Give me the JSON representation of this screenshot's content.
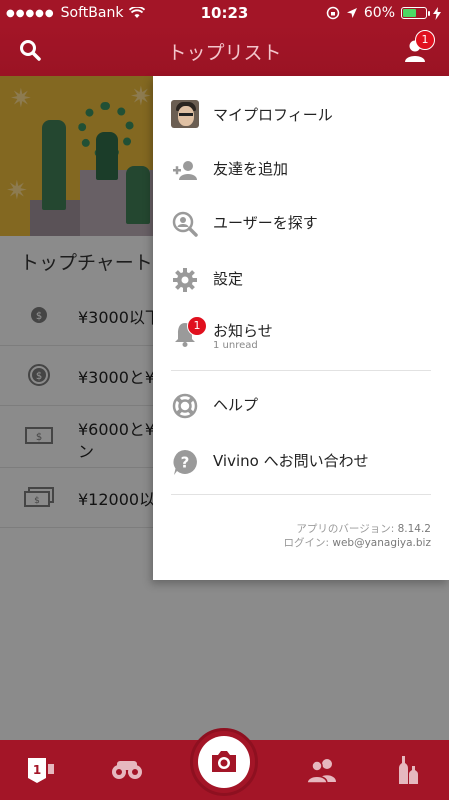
{
  "status_bar": {
    "carrier": "SoftBank",
    "time": "10:23",
    "battery_pct": "60%",
    "battery_level": 0.6
  },
  "nav": {
    "title": "トップリスト",
    "notification_count": "1"
  },
  "background": {
    "section_title": "トップチャート",
    "rows": [
      {
        "line1": "¥3000以下",
        "line2": ""
      },
      {
        "line1": "¥3000と¥",
        "line2": ""
      },
      {
        "line1": "¥6000と¥",
        "line2": "ン"
      },
      {
        "line1": "¥12000以",
        "line2": ""
      }
    ]
  },
  "menu": {
    "items": [
      {
        "label": "マイプロフィール",
        "icon": "avatar"
      },
      {
        "label": "友達を追加",
        "icon": "add-friend-icon"
      },
      {
        "label": "ユーザーを探す",
        "icon": "search-user-icon"
      },
      {
        "label": "設定",
        "icon": "gear-icon"
      },
      {
        "label": "お知らせ",
        "sub": "1 unread",
        "badge": "1",
        "icon": "bell-icon"
      },
      {
        "label": "ヘルプ",
        "icon": "lifebuoy-icon"
      },
      {
        "label": "Vivino へお問い合わせ",
        "icon": "question-icon"
      }
    ],
    "version_label": "アプリのバージョン:",
    "version": "8.14.2",
    "login_label": "ログイン:",
    "login": "web@yanagiya.biz"
  },
  "colors": {
    "brand": "#a31527",
    "badge": "#e0101e"
  },
  "tabbar": {
    "tabs": [
      "top-lists-icon",
      "explore-icon",
      "camera-icon",
      "friends-icon",
      "my-wines-icon"
    ]
  }
}
